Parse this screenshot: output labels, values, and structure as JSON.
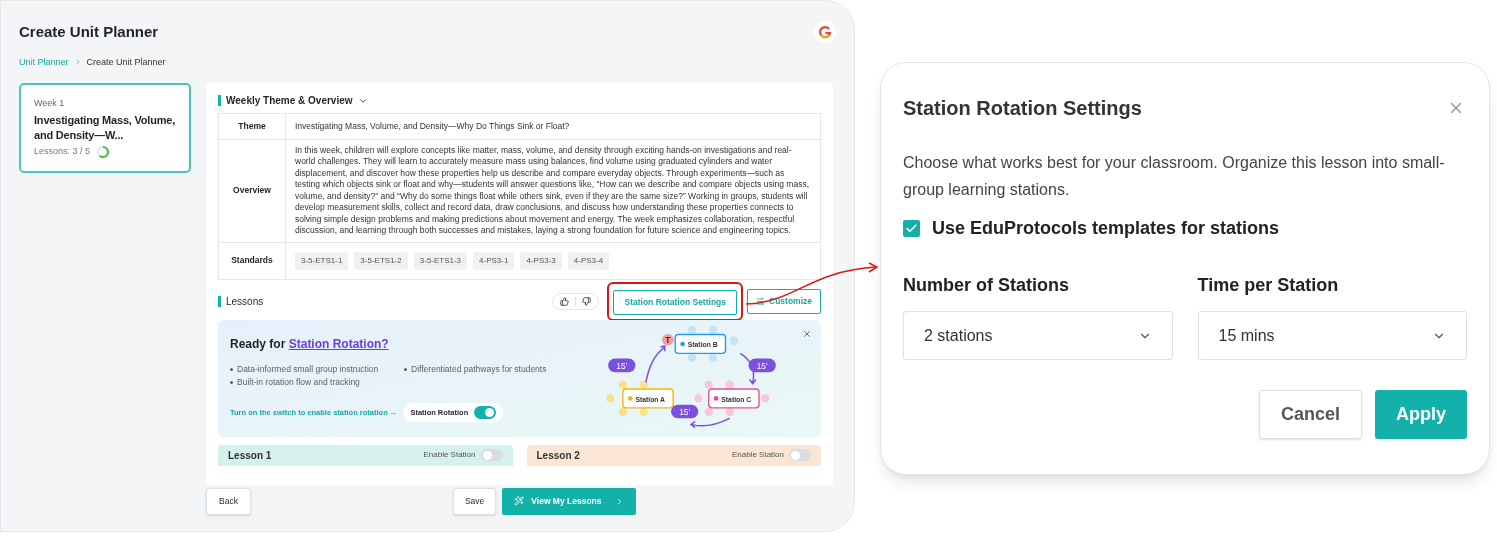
{
  "page": {
    "title": "Create Unit Planner",
    "breadcrumb": [
      {
        "label": "Unit Planner",
        "link": true
      },
      {
        "label": "Create Unit Planner",
        "link": false
      }
    ]
  },
  "weeks": [
    {
      "label": "Week 1",
      "title": "Investigating Mass, Volume, and Density—W...",
      "progress": "Lessons: 3 / 5",
      "level": 0.6,
      "selected": true
    }
  ],
  "overview": {
    "heading": "Weekly Theme & Overview",
    "expanded": true,
    "rows": [
      {
        "kind": "text",
        "label": "Theme",
        "value": "Investigating Mass, Volume, and Density—Why Do Things Sink or Float?"
      },
      {
        "kind": "text",
        "label": "Overview",
        "value": "In this week, children will explore concepts like matter, mass, volume, and density through exciting hands-on investigations and real-world challenges. They will learn to accurately measure mass using balances, find volume using graduated cylinders and water displacement, and discover how these properties help us describe and compare everyday objects. Through experiments—such as testing which objects sink or float and why—students will answer questions like, “How can we describe and compare objects using mass, volume, and density?” and “Why do some things float while others sink, even if they are the same size?” Working in groups, students will develop measurement skills, collect and record data, draw conclusions, and discuss how understanding these properties connects to solving simple design problems and making predictions about movement and energy. The week emphasizes collaboration, respectful discussion, and learning through both successes and mistakes, laying a strong foundation for future science and engineering topics."
      },
      {
        "kind": "tags",
        "label": "Standards",
        "tags": [
          "3-5-ETS1-1",
          "3-5-ETS1-2",
          "3-5-ETS1-3",
          "4-PS3-1",
          "4-PS3-3",
          "4-PS3-4"
        ]
      }
    ]
  },
  "lessons": {
    "heading": "Lessons",
    "settings_button": "Station Rotation Settings",
    "customize_button": "Customize"
  },
  "banner": {
    "title": "Ready for",
    "title_accent": "Station Rotation?",
    "bullets": [
      "Data-informed small group instruction",
      "Differentiated pathways for students",
      "Built-in rotation flow and tracking"
    ],
    "hint": "Turn on the switch to enable station rotation →",
    "toggle": {
      "label": "Station Rotation",
      "on": true
    },
    "diagram": {
      "teacher": "T",
      "stations": [
        {
          "name": "Station B",
          "color": "#1d9bf0"
        },
        {
          "name": "Station A",
          "color": "#f5b800"
        },
        {
          "name": "Station C",
          "color": "#e8508a"
        }
      ],
      "durations": [
        "15'",
        "15'",
        "15'"
      ]
    }
  },
  "lesson_cards": [
    {
      "title": "Lesson 1",
      "toggle_label": "Enable Station",
      "on": false,
      "color": "#d6f0ee"
    },
    {
      "title": "Lesson 2",
      "toggle_label": "Enable Station",
      "on": false,
      "color": "#fbe6d6"
    }
  ],
  "footer": {
    "back": "Back",
    "save": "Save",
    "primary": "View My Lessons"
  },
  "modal": {
    "title": "Station Rotation Settings",
    "description": "Choose what works best for your classroom. Organize this lesson into small-group learning stations.",
    "checkbox": {
      "label": "Use EduProtocols templates for stations",
      "checked": true
    },
    "fields": [
      {
        "label": "Number of Stations",
        "value": "2 stations"
      },
      {
        "label": "Time per Station",
        "value": "15 mins"
      }
    ],
    "cancel": "Cancel",
    "apply": "Apply"
  }
}
